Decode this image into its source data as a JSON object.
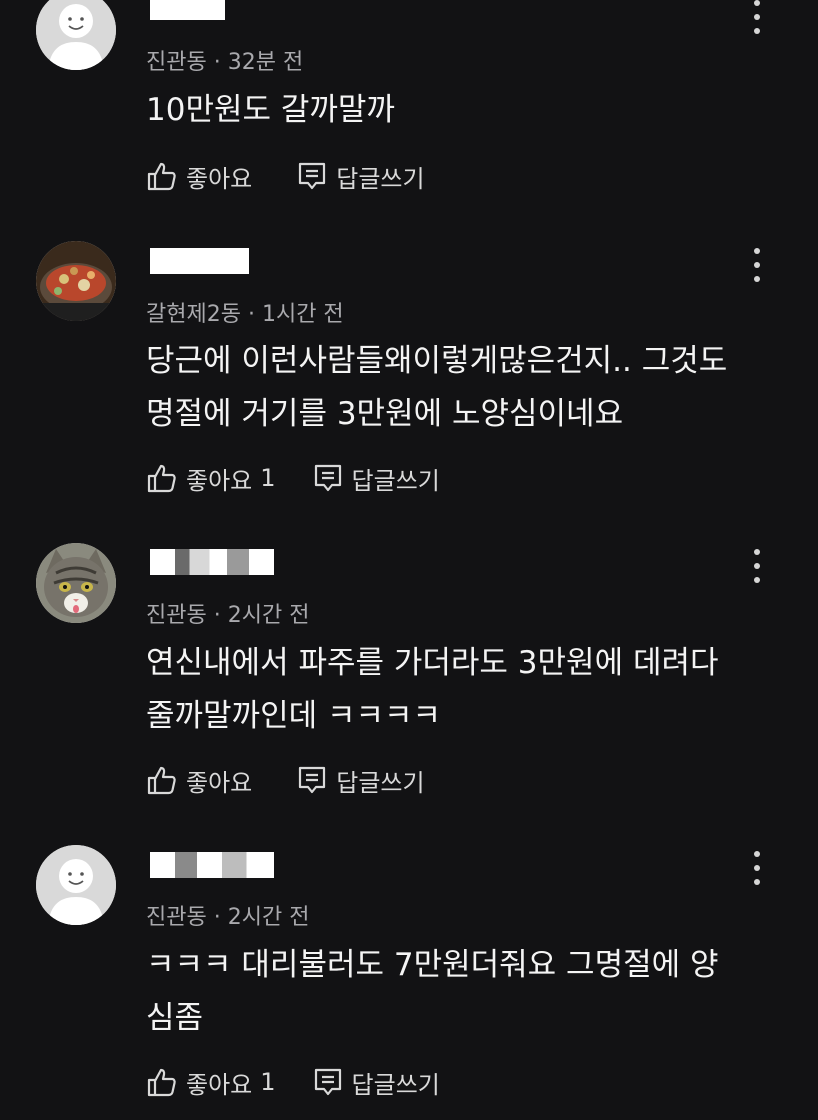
{
  "comments": [
    {
      "location": "진관동",
      "time": "32분 전",
      "text": "10만원도 갈까말까",
      "like_label": "좋아요",
      "like_count": "",
      "reply_label": "답글쓰기",
      "avatar": "default-person-avatar"
    },
    {
      "location": "갈현제2동",
      "time": "1시간 전",
      "text": "당근에 이런사람들왜이렇게많은건지.. 그것도\n명절에 거기를 3만원에 노양심이네요",
      "like_label": "좋아요",
      "like_count": "1",
      "reply_label": "답글쓰기",
      "avatar": "food-photo-avatar"
    },
    {
      "location": "진관동",
      "time": "2시간 전",
      "text": "연신내에서 파주를 가더라도 3만원에 데려다\n줄까말까인데 ㅋㅋㅋㅋ",
      "like_label": "좋아요",
      "like_count": "",
      "reply_label": "답글쓰기",
      "avatar": "cat-photo-avatar"
    },
    {
      "location": "진관동",
      "time": "2시간 전",
      "text": "ㅋㅋㅋ 대리불러도 7만원더줘요 그명절에 양\n심좀",
      "like_label": "좋아요",
      "like_count": "1",
      "reply_label": "답글쓰기",
      "avatar": "default-person-avatar"
    }
  ],
  "meta_separator": " · ",
  "icons": {
    "like": "thumbs-up-icon",
    "reply": "reply-comment-icon",
    "more": "more-vertical-icon"
  },
  "colors": {
    "background": "#121214",
    "primary_text": "#f4f4f4",
    "secondary_text": "#a9a9ad"
  }
}
